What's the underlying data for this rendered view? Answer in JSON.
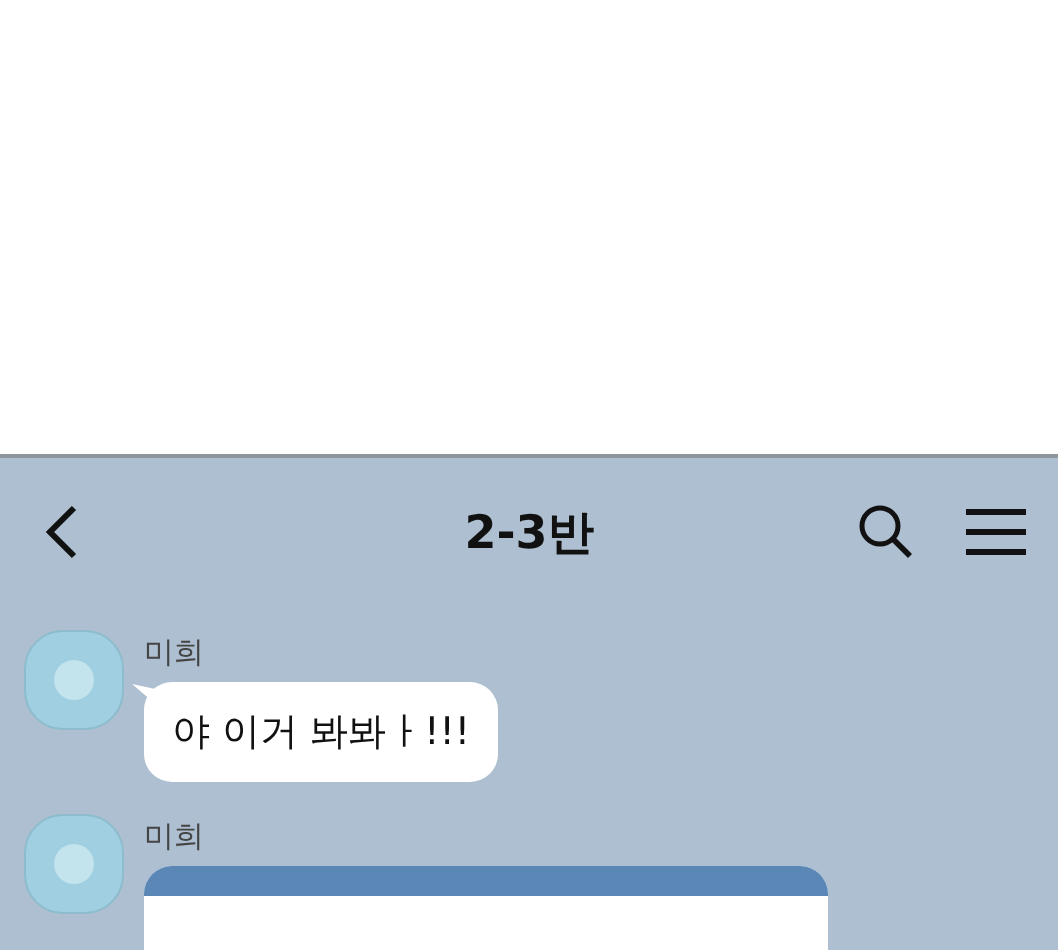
{
  "chat_header": {
    "title": "2-3반"
  },
  "messages": [
    {
      "kind": "text",
      "sender": "미희",
      "text": "야 이거 봐봐ㅏ!!!"
    },
    {
      "kind": "card",
      "sender": "미희"
    }
  ]
}
